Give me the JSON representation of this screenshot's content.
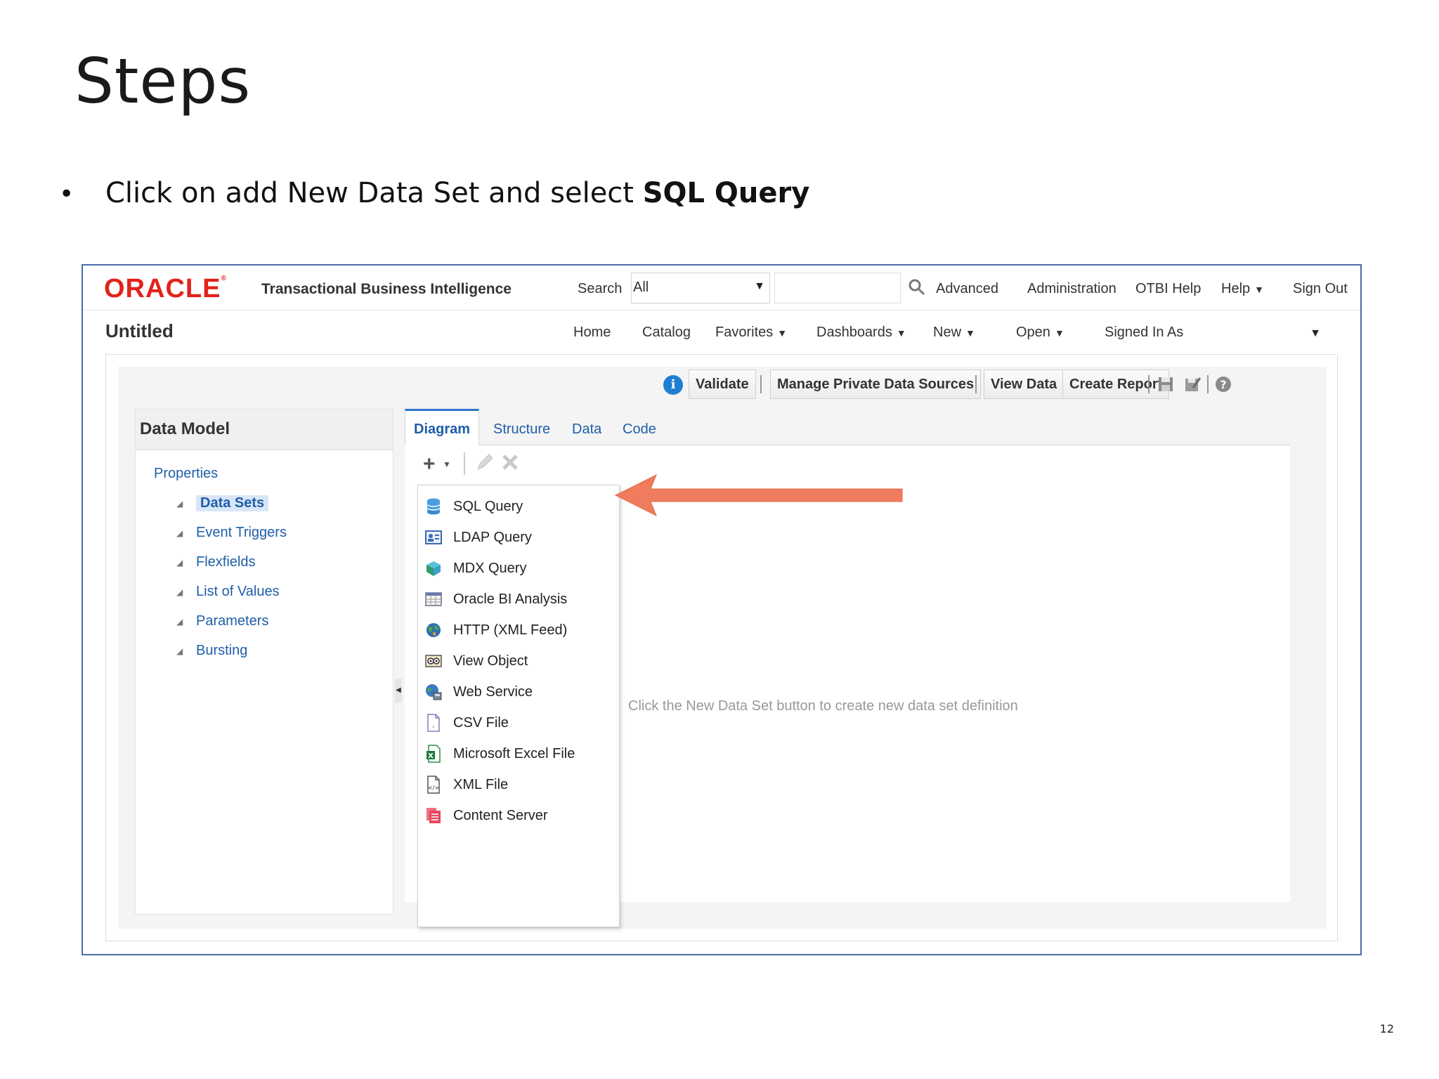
{
  "slide": {
    "title": "Steps",
    "bullet_prefix": "Click on add New Data Set and select ",
    "bullet_bold": "SQL Query",
    "page_number": "12"
  },
  "topbar": {
    "logo": "ORACLE",
    "app_name": "Transactional Business Intelligence",
    "search_label": "Search",
    "search_scope": "All",
    "links": [
      "Advanced",
      "Administration",
      "OTBI Help",
      "Help",
      "Sign Out"
    ]
  },
  "navbar": {
    "doc_title": "Untitled",
    "links": [
      "Home",
      "Catalog",
      "Favorites",
      "Dashboards",
      "New",
      "Open",
      "Signed In As"
    ]
  },
  "toolbar": {
    "validate": "Validate",
    "manage_sources": "Manage Private Data Sources",
    "view_data": "View Data",
    "create_report": "Create Report"
  },
  "left_panel": {
    "header": "Data Model",
    "properties": "Properties",
    "items": [
      "Data Sets",
      "Event Triggers",
      "Flexfields",
      "List of Values",
      "Parameters",
      "Bursting"
    ]
  },
  "tabs": [
    "Diagram",
    "Structure",
    "Data",
    "Code"
  ],
  "menu": {
    "items": [
      {
        "label": "SQL Query",
        "icon": "database-icon"
      },
      {
        "label": "LDAP Query",
        "icon": "ldap-icon"
      },
      {
        "label": "MDX Query",
        "icon": "cube-icon"
      },
      {
        "label": "Oracle BI Analysis",
        "icon": "analysis-icon"
      },
      {
        "label": "HTTP (XML Feed)",
        "icon": "globe-icon"
      },
      {
        "label": "View Object",
        "icon": "view-object-icon"
      },
      {
        "label": "Web Service",
        "icon": "web-service-icon"
      },
      {
        "label": "CSV File",
        "icon": "csv-file-icon"
      },
      {
        "label": "Microsoft Excel File",
        "icon": "excel-file-icon"
      },
      {
        "label": "XML File",
        "icon": "xml-file-icon"
      },
      {
        "label": "Content Server",
        "icon": "content-server-icon"
      }
    ]
  },
  "canvas_hint": "Click the New Data Set button to create new data set definition",
  "colors": {
    "oracle_red": "#e2231a",
    "link_blue": "#1f5ea8",
    "arrow": "#f07c5e",
    "tab_accent": "#2e74c8"
  }
}
